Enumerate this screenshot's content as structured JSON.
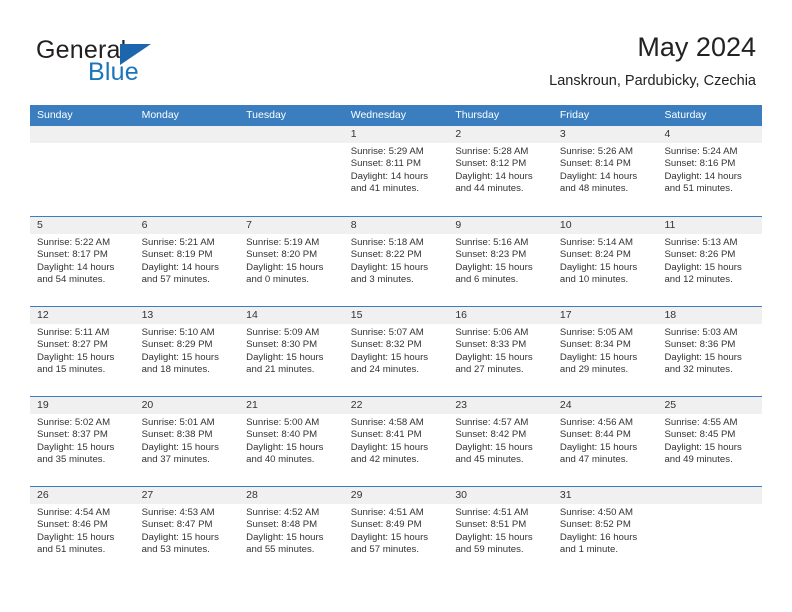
{
  "brand": {
    "name_part1": "General",
    "name_part2": "Blue",
    "triangle_icon": "triangle-logo-icon",
    "accent_color": "#1b75bb"
  },
  "header": {
    "title": "May 2024",
    "subtitle": "Lanskroun, Pardubicky, Czechia"
  },
  "colors": {
    "header_band": "#3a7ebf",
    "daterow_band": "#f0f0f0",
    "text": "#333333"
  },
  "weekdays": [
    "Sunday",
    "Monday",
    "Tuesday",
    "Wednesday",
    "Thursday",
    "Friday",
    "Saturday"
  ],
  "weeks": [
    {
      "cells": [
        {
          "day": "",
          "sunrise": "",
          "sunset": "",
          "daylight1": "",
          "daylight2": ""
        },
        {
          "day": "",
          "sunrise": "",
          "sunset": "",
          "daylight1": "",
          "daylight2": ""
        },
        {
          "day": "",
          "sunrise": "",
          "sunset": "",
          "daylight1": "",
          "daylight2": ""
        },
        {
          "day": "1",
          "sunrise": "Sunrise: 5:29 AM",
          "sunset": "Sunset: 8:11 PM",
          "daylight1": "Daylight: 14 hours",
          "daylight2": "and 41 minutes."
        },
        {
          "day": "2",
          "sunrise": "Sunrise: 5:28 AM",
          "sunset": "Sunset: 8:12 PM",
          "daylight1": "Daylight: 14 hours",
          "daylight2": "and 44 minutes."
        },
        {
          "day": "3",
          "sunrise": "Sunrise: 5:26 AM",
          "sunset": "Sunset: 8:14 PM",
          "daylight1": "Daylight: 14 hours",
          "daylight2": "and 48 minutes."
        },
        {
          "day": "4",
          "sunrise": "Sunrise: 5:24 AM",
          "sunset": "Sunset: 8:16 PM",
          "daylight1": "Daylight: 14 hours",
          "daylight2": "and 51 minutes."
        }
      ]
    },
    {
      "cells": [
        {
          "day": "5",
          "sunrise": "Sunrise: 5:22 AM",
          "sunset": "Sunset: 8:17 PM",
          "daylight1": "Daylight: 14 hours",
          "daylight2": "and 54 minutes."
        },
        {
          "day": "6",
          "sunrise": "Sunrise: 5:21 AM",
          "sunset": "Sunset: 8:19 PM",
          "daylight1": "Daylight: 14 hours",
          "daylight2": "and 57 minutes."
        },
        {
          "day": "7",
          "sunrise": "Sunrise: 5:19 AM",
          "sunset": "Sunset: 8:20 PM",
          "daylight1": "Daylight: 15 hours",
          "daylight2": "and 0 minutes."
        },
        {
          "day": "8",
          "sunrise": "Sunrise: 5:18 AM",
          "sunset": "Sunset: 8:22 PM",
          "daylight1": "Daylight: 15 hours",
          "daylight2": "and 3 minutes."
        },
        {
          "day": "9",
          "sunrise": "Sunrise: 5:16 AM",
          "sunset": "Sunset: 8:23 PM",
          "daylight1": "Daylight: 15 hours",
          "daylight2": "and 6 minutes."
        },
        {
          "day": "10",
          "sunrise": "Sunrise: 5:14 AM",
          "sunset": "Sunset: 8:24 PM",
          "daylight1": "Daylight: 15 hours",
          "daylight2": "and 10 minutes."
        },
        {
          "day": "11",
          "sunrise": "Sunrise: 5:13 AM",
          "sunset": "Sunset: 8:26 PM",
          "daylight1": "Daylight: 15 hours",
          "daylight2": "and 12 minutes."
        }
      ]
    },
    {
      "cells": [
        {
          "day": "12",
          "sunrise": "Sunrise: 5:11 AM",
          "sunset": "Sunset: 8:27 PM",
          "daylight1": "Daylight: 15 hours",
          "daylight2": "and 15 minutes."
        },
        {
          "day": "13",
          "sunrise": "Sunrise: 5:10 AM",
          "sunset": "Sunset: 8:29 PM",
          "daylight1": "Daylight: 15 hours",
          "daylight2": "and 18 minutes."
        },
        {
          "day": "14",
          "sunrise": "Sunrise: 5:09 AM",
          "sunset": "Sunset: 8:30 PM",
          "daylight1": "Daylight: 15 hours",
          "daylight2": "and 21 minutes."
        },
        {
          "day": "15",
          "sunrise": "Sunrise: 5:07 AM",
          "sunset": "Sunset: 8:32 PM",
          "daylight1": "Daylight: 15 hours",
          "daylight2": "and 24 minutes."
        },
        {
          "day": "16",
          "sunrise": "Sunrise: 5:06 AM",
          "sunset": "Sunset: 8:33 PM",
          "daylight1": "Daylight: 15 hours",
          "daylight2": "and 27 minutes."
        },
        {
          "day": "17",
          "sunrise": "Sunrise: 5:05 AM",
          "sunset": "Sunset: 8:34 PM",
          "daylight1": "Daylight: 15 hours",
          "daylight2": "and 29 minutes."
        },
        {
          "day": "18",
          "sunrise": "Sunrise: 5:03 AM",
          "sunset": "Sunset: 8:36 PM",
          "daylight1": "Daylight: 15 hours",
          "daylight2": "and 32 minutes."
        }
      ]
    },
    {
      "cells": [
        {
          "day": "19",
          "sunrise": "Sunrise: 5:02 AM",
          "sunset": "Sunset: 8:37 PM",
          "daylight1": "Daylight: 15 hours",
          "daylight2": "and 35 minutes."
        },
        {
          "day": "20",
          "sunrise": "Sunrise: 5:01 AM",
          "sunset": "Sunset: 8:38 PM",
          "daylight1": "Daylight: 15 hours",
          "daylight2": "and 37 minutes."
        },
        {
          "day": "21",
          "sunrise": "Sunrise: 5:00 AM",
          "sunset": "Sunset: 8:40 PM",
          "daylight1": "Daylight: 15 hours",
          "daylight2": "and 40 minutes."
        },
        {
          "day": "22",
          "sunrise": "Sunrise: 4:58 AM",
          "sunset": "Sunset: 8:41 PM",
          "daylight1": "Daylight: 15 hours",
          "daylight2": "and 42 minutes."
        },
        {
          "day": "23",
          "sunrise": "Sunrise: 4:57 AM",
          "sunset": "Sunset: 8:42 PM",
          "daylight1": "Daylight: 15 hours",
          "daylight2": "and 45 minutes."
        },
        {
          "day": "24",
          "sunrise": "Sunrise: 4:56 AM",
          "sunset": "Sunset: 8:44 PM",
          "daylight1": "Daylight: 15 hours",
          "daylight2": "and 47 minutes."
        },
        {
          "day": "25",
          "sunrise": "Sunrise: 4:55 AM",
          "sunset": "Sunset: 8:45 PM",
          "daylight1": "Daylight: 15 hours",
          "daylight2": "and 49 minutes."
        }
      ]
    },
    {
      "cells": [
        {
          "day": "26",
          "sunrise": "Sunrise: 4:54 AM",
          "sunset": "Sunset: 8:46 PM",
          "daylight1": "Daylight: 15 hours",
          "daylight2": "and 51 minutes."
        },
        {
          "day": "27",
          "sunrise": "Sunrise: 4:53 AM",
          "sunset": "Sunset: 8:47 PM",
          "daylight1": "Daylight: 15 hours",
          "daylight2": "and 53 minutes."
        },
        {
          "day": "28",
          "sunrise": "Sunrise: 4:52 AM",
          "sunset": "Sunset: 8:48 PM",
          "daylight1": "Daylight: 15 hours",
          "daylight2": "and 55 minutes."
        },
        {
          "day": "29",
          "sunrise": "Sunrise: 4:51 AM",
          "sunset": "Sunset: 8:49 PM",
          "daylight1": "Daylight: 15 hours",
          "daylight2": "and 57 minutes."
        },
        {
          "day": "30",
          "sunrise": "Sunrise: 4:51 AM",
          "sunset": "Sunset: 8:51 PM",
          "daylight1": "Daylight: 15 hours",
          "daylight2": "and 59 minutes."
        },
        {
          "day": "31",
          "sunrise": "Sunrise: 4:50 AM",
          "sunset": "Sunset: 8:52 PM",
          "daylight1": "Daylight: 16 hours",
          "daylight2": "and 1 minute."
        },
        {
          "day": "",
          "sunrise": "",
          "sunset": "",
          "daylight1": "",
          "daylight2": ""
        }
      ]
    }
  ]
}
